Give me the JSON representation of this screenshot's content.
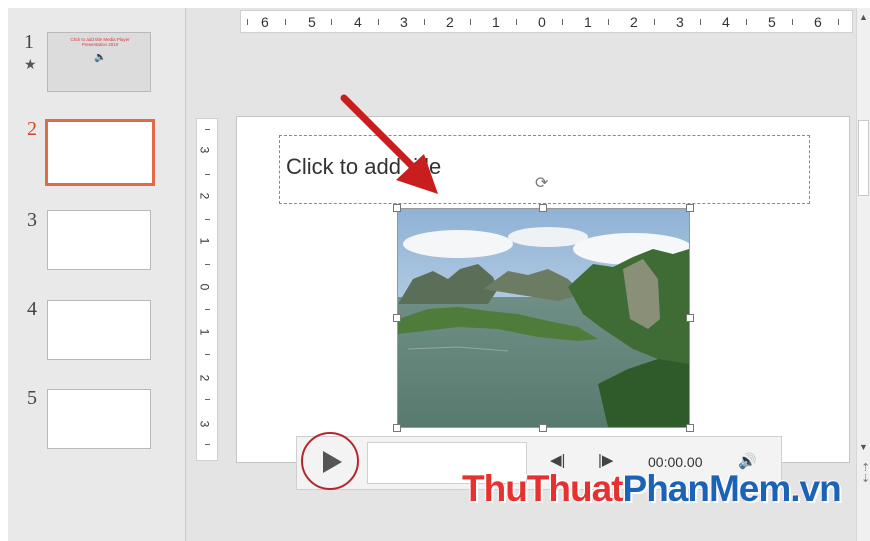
{
  "thumbnails": {
    "slides": [
      {
        "number": "1",
        "selected": false,
        "has_animation": true
      },
      {
        "number": "2",
        "selected": true
      },
      {
        "number": "3",
        "selected": false
      },
      {
        "number": "4",
        "selected": false
      },
      {
        "number": "5",
        "selected": false
      }
    ],
    "slide1_mini_text": "Click to add title Media Player Presentation 2010",
    "selection_color": "#e16a47"
  },
  "ruler_horizontal": [
    "6",
    "5",
    "4",
    "3",
    "2",
    "1",
    "0",
    "1",
    "2",
    "3",
    "4",
    "5",
    "6"
  ],
  "ruler_vertical": [
    "3",
    "2",
    "1",
    "0",
    "1",
    "2",
    "3"
  ],
  "slide": {
    "title_placeholder": "Click to add title"
  },
  "media_controls": {
    "time": "00:00.00",
    "play_icon": "play-icon",
    "prev_icon": "previous-frame-icon",
    "next_icon": "next-frame-icon",
    "volume_icon": "volume-icon",
    "highlight_color": "#b3282d"
  },
  "annotation": {
    "arrow_color": "#c81e1e"
  },
  "watermark": {
    "part1": "ThuThuat",
    "part2": "PhanMem.vn",
    "color1": "#e8312f",
    "color2": "#1b63b6"
  }
}
